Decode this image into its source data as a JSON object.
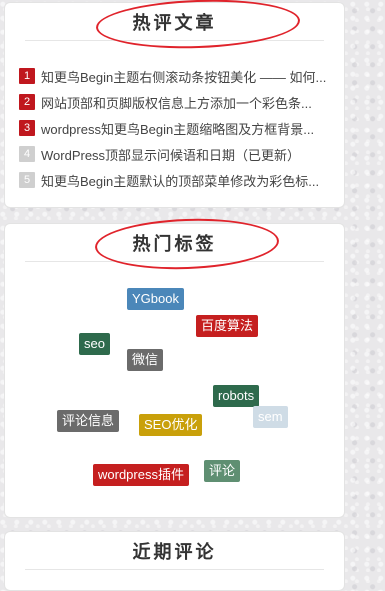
{
  "hot_comments": {
    "title": "热评文章",
    "items": [
      {
        "rank": "1",
        "text": "知更鸟Begin主题右侧滚动条按钮美化 —— 如何..."
      },
      {
        "rank": "2",
        "text": "网站顶部和页脚版权信息上方添加一个彩色条..."
      },
      {
        "rank": "3",
        "text": "wordpress知更鸟Begin主题缩略图及方框背景..."
      },
      {
        "rank": "4",
        "text": "WordPress顶部显示问候语和日期（已更新）"
      },
      {
        "rank": "5",
        "text": "知更鸟Begin主题默认的顶部菜单修改为彩色标..."
      }
    ]
  },
  "hot_tags": {
    "title": "热门标签",
    "tags": [
      {
        "label": "YGbook",
        "color": "#4b87b9"
      },
      {
        "label": "百度算法",
        "color": "#c51f1f"
      },
      {
        "label": "seo",
        "color": "#2e6a4c"
      },
      {
        "label": "微信",
        "color": "#6b6b6b"
      },
      {
        "label": "robots",
        "color": "#2e6a4c"
      },
      {
        "label": "sem",
        "color": "#cfdce6"
      },
      {
        "label": "评论信息",
        "color": "#6b6b6b"
      },
      {
        "label": "SEO优化",
        "color": "#c9a00a"
      },
      {
        "label": "wordpress插件",
        "color": "#c51f1f"
      },
      {
        "label": "评论",
        "color": "#5f8f72"
      }
    ]
  },
  "recent_comments": {
    "title": "近期评论"
  },
  "colors": {
    "accent_red": "#c0171e",
    "annotation_ring": "#e0232b"
  }
}
